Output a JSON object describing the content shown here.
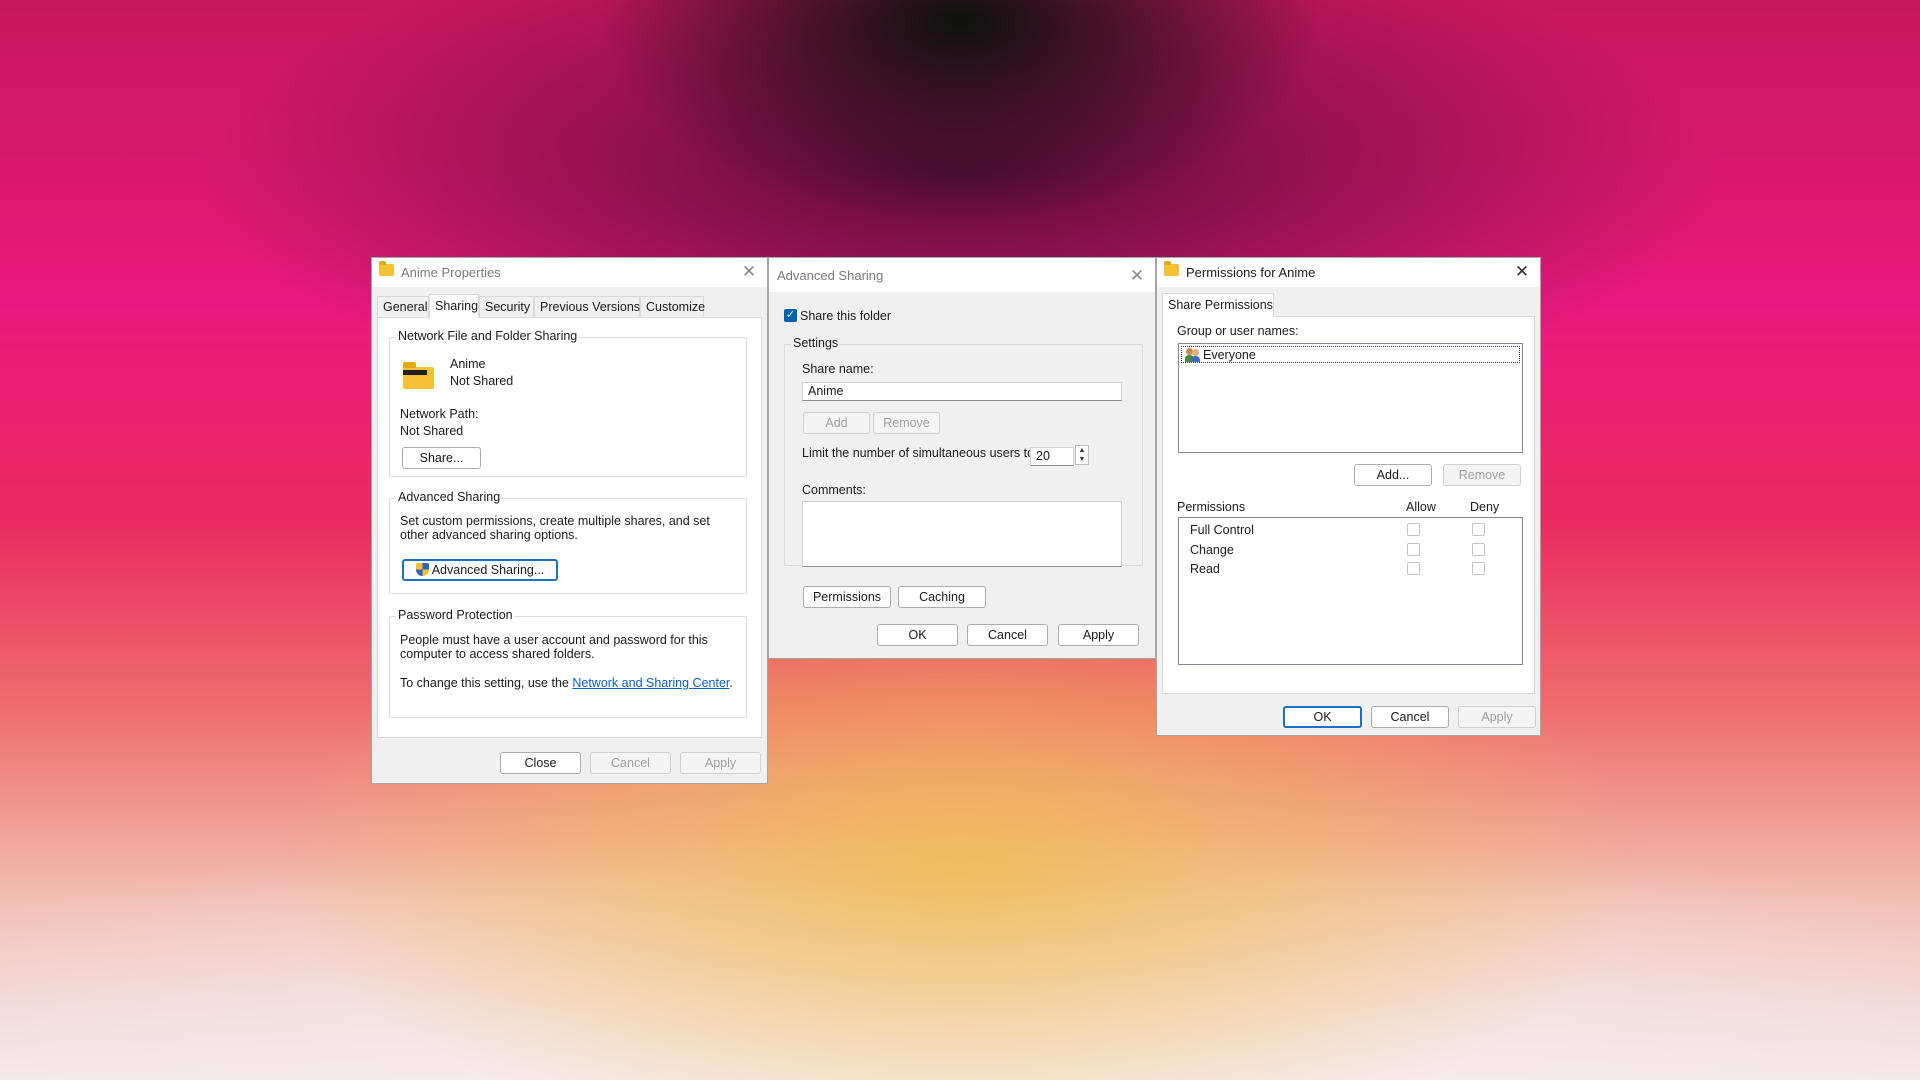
{
  "properties": {
    "title": "Anime Properties",
    "close_glyph": "✕",
    "tabs": [
      "General",
      "Sharing",
      "Security",
      "Previous Versions",
      "Customize"
    ],
    "network_sharing": {
      "label": "Network File and Folder Sharing",
      "folder_name": "Anime",
      "folder_status": "Not Shared",
      "path_label": "Network Path:",
      "path_value": "Not Shared",
      "share_button": "Share..."
    },
    "advanced_sharing": {
      "label": "Advanced Sharing",
      "description": "Set custom permissions, create multiple shares, and set other advanced sharing options.",
      "button": "Advanced Sharing..."
    },
    "password_protection": {
      "label": "Password Protection",
      "description": "People must have a user account and password for this computer to access shared folders.",
      "change_prefix": "To change this setting, use the ",
      "link": "Network and Sharing Center",
      "change_suffix": "."
    },
    "buttons": {
      "close": "Close",
      "cancel": "Cancel",
      "apply": "Apply"
    }
  },
  "advanced": {
    "title": "Advanced Sharing",
    "close_glyph": "✕",
    "share_checkbox_label": "Share this folder",
    "share_checked": true,
    "check_glyph": "✓",
    "settings_label": "Settings",
    "share_name_label": "Share name:",
    "share_name_value": "Anime",
    "add_button": "Add",
    "remove_button": "Remove",
    "limit_label": "Limit the number of simultaneous users to:",
    "limit_value": "20",
    "spin_up": "▲",
    "spin_down": "▼",
    "comments_label": "Comments:",
    "permissions_button": "Permissions",
    "caching_button": "Caching",
    "buttons": {
      "ok": "OK",
      "cancel": "Cancel",
      "apply": "Apply"
    }
  },
  "permissions": {
    "title": "Permissions for Anime",
    "close_glyph": "✕",
    "tab": "Share Permissions",
    "group_label": "Group or user names:",
    "users": [
      "Everyone"
    ],
    "add_button": "Add...",
    "remove_button": "Remove",
    "permissions_header": "Permissions",
    "allow_header": "Allow",
    "deny_header": "Deny",
    "rows": [
      {
        "name": "Full Control",
        "allow": false,
        "deny": false
      },
      {
        "name": "Change",
        "allow": false,
        "deny": false
      },
      {
        "name": "Read",
        "allow": false,
        "deny": false
      }
    ],
    "buttons": {
      "ok": "OK",
      "cancel": "Cancel",
      "apply": "Apply"
    }
  }
}
